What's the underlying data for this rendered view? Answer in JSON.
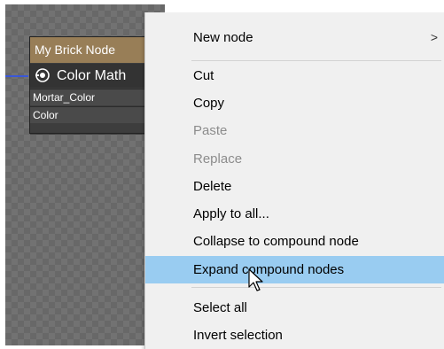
{
  "node": {
    "title": "My Brick Node",
    "header": "Color  Math",
    "header_icon": "target-icon",
    "rows": [
      "Mortar_Color",
      "Color"
    ]
  },
  "menu": {
    "items": [
      {
        "label": "New node",
        "submenu": true,
        "state": "normal"
      },
      {
        "label": "Cut",
        "state": "normal"
      },
      {
        "label": "Copy",
        "state": "normal"
      },
      {
        "label": "Paste",
        "state": "disabled"
      },
      {
        "label": "Replace",
        "state": "disabled"
      },
      {
        "label": "Delete",
        "state": "normal"
      },
      {
        "label": "Apply to all...",
        "state": "normal"
      },
      {
        "label": "Collapse to compound node",
        "state": "normal"
      },
      {
        "label": "Expand compound nodes",
        "state": "hover"
      },
      {
        "label": "Select all",
        "state": "normal"
      },
      {
        "label": "Invert selection",
        "state": "normal"
      }
    ],
    "submenu_arrow": ">"
  },
  "colors": {
    "node_title_bg": "#987e57",
    "menu_bg": "#f0f0f0",
    "highlight": "#99ccf1",
    "wire": "#3a57d8"
  }
}
